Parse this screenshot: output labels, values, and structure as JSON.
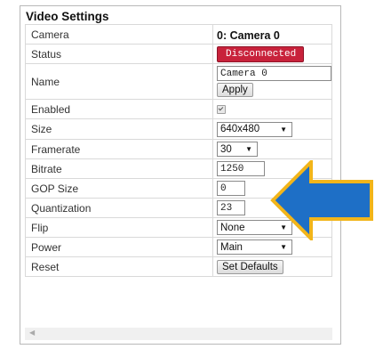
{
  "panel": {
    "title": "Video Settings"
  },
  "rows": {
    "camera": {
      "label": "Camera",
      "value": "0: Camera 0"
    },
    "status": {
      "label": "Status",
      "value": "Disconnected"
    },
    "name": {
      "label": "Name",
      "value": "Camera 0",
      "apply": "Apply"
    },
    "enabled": {
      "label": "Enabled",
      "checked": true
    },
    "size": {
      "label": "Size",
      "value": "640x480"
    },
    "framerate": {
      "label": "Framerate",
      "value": "30"
    },
    "bitrate": {
      "label": "Bitrate",
      "value": "1250"
    },
    "gop_size": {
      "label": "GOP Size",
      "value": "0"
    },
    "quantization": {
      "label": "Quantization",
      "value": "23"
    },
    "flip": {
      "label": "Flip",
      "value": "None"
    },
    "power": {
      "label": "Power",
      "value": "Main"
    },
    "reset": {
      "label": "Reset",
      "button": "Set Defaults"
    }
  },
  "icons": {
    "dropdown": "triangle-down-icon",
    "scroll": "triangle-left-icon",
    "highlight": "arrow-left-icon"
  },
  "colors": {
    "status_badge": "#c8223b",
    "arrow_fill": "#1e6fc6",
    "arrow_stroke": "#f2b51a"
  }
}
